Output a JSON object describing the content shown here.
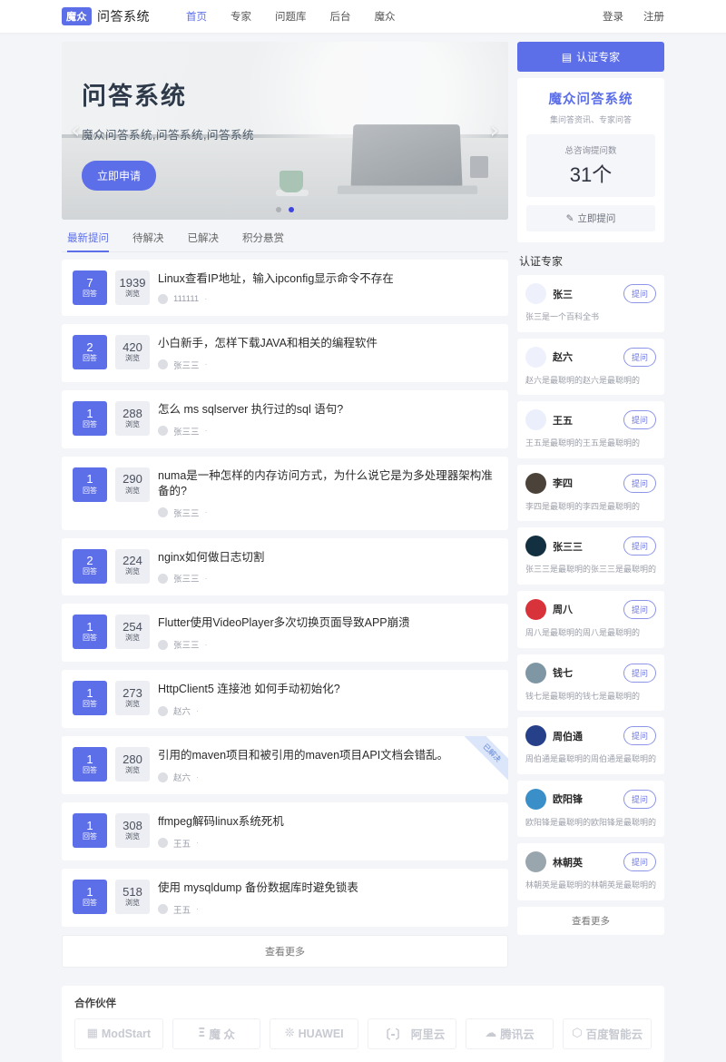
{
  "nav": {
    "logo_badge": "魔众",
    "logo_title": "问答系统",
    "links": [
      {
        "label": "首页",
        "active": true
      },
      {
        "label": "专家",
        "active": false
      },
      {
        "label": "问题库",
        "active": false
      },
      {
        "label": "后台",
        "active": false
      },
      {
        "label": "魔众",
        "active": false
      }
    ],
    "login": "登录",
    "register": "注册"
  },
  "carousel": {
    "heading": "问答系统",
    "subtitle": "魔众问答系统,问答系统,问答系统",
    "cta": "立即申请",
    "prev_icon": "chevron-left-icon",
    "next_icon": "chevron-right-icon",
    "dots": 2,
    "active_dot": 1
  },
  "tabs": [
    {
      "label": "最新提问",
      "active": true
    },
    {
      "label": "待解决",
      "active": false
    },
    {
      "label": "已解决",
      "active": false
    },
    {
      "label": "积分悬赏",
      "active": false
    }
  ],
  "question_labels": {
    "answers": "回答",
    "views": "浏览",
    "dot": "·"
  },
  "questions": [
    {
      "answers": "7",
      "views": "1939",
      "title": "Linux查看IP地址，输入ipconfig显示命令不存在",
      "author": "111111",
      "ribbon": ""
    },
    {
      "answers": "2",
      "views": "420",
      "title": "小白新手，怎样下载JAVA和相关的编程软件",
      "author": "张三三",
      "ribbon": ""
    },
    {
      "answers": "1",
      "views": "288",
      "title": "怎么 ms sqlserver 执行过的sql 语句?",
      "author": "张三三",
      "ribbon": ""
    },
    {
      "answers": "1",
      "views": "290",
      "title": "numa是一种怎样的内存访问方式，为什么说它是为多处理器架构准备的?",
      "author": "张三三",
      "ribbon": ""
    },
    {
      "answers": "2",
      "views": "224",
      "title": "nginx如何做日志切割",
      "author": "张三三",
      "ribbon": ""
    },
    {
      "answers": "1",
      "views": "254",
      "title": "Flutter使用VideoPlayer多次切换页面导致APP崩溃",
      "author": "张三三",
      "ribbon": ""
    },
    {
      "answers": "1",
      "views": "273",
      "title": "HttpClient5 连接池 如何手动初始化?",
      "author": "赵六",
      "ribbon": ""
    },
    {
      "answers": "1",
      "views": "280",
      "title": "引用的maven项目和被引用的maven项目API文档会错乱。",
      "author": "赵六",
      "ribbon": "已解决"
    },
    {
      "answers": "1",
      "views": "308",
      "title": "ffmpeg解码linux系统死机",
      "author": "王五",
      "ribbon": ""
    },
    {
      "answers": "1",
      "views": "518",
      "title": "使用 mysqldump 备份数据库时避免锁表",
      "author": "王五",
      "ribbon": ""
    }
  ],
  "list_more": "查看更多",
  "sidebar": {
    "header": "认证专家",
    "header_icon": "card-icon",
    "card_title": "魔众问答系统",
    "card_subtitle": "集问答资讯、专家问答",
    "stat_caption": "总咨询提问数",
    "stat_value": "31个",
    "ask_button": "立即提问",
    "ask_icon": "pen-icon",
    "experts_title": "认证专家",
    "ask_label": "提问",
    "experts": [
      {
        "name": "张三",
        "desc": "张三是一个百科全书",
        "avatar_color": "#eef1fb"
      },
      {
        "name": "赵六",
        "desc": "赵六是最聪明的赵六是最聪明的",
        "avatar_color": "#eef1fb"
      },
      {
        "name": "王五",
        "desc": "王五是最聪明的王五是最聪明的",
        "avatar_color": "#eaeffb"
      },
      {
        "name": "李四",
        "desc": "李四是最聪明的李四是最聪明的",
        "avatar_color": "#4b4339"
      },
      {
        "name": "张三三",
        "desc": "张三三是最聪明的张三三是最聪明的",
        "avatar_color": "#12303f"
      },
      {
        "name": "周八",
        "desc": "周八是最聪明的周八是最聪明的",
        "avatar_color": "#d8333a"
      },
      {
        "name": "钱七",
        "desc": "钱七是最聪明的钱七是最聪明的",
        "avatar_color": "#7f97a5"
      },
      {
        "name": "周伯通",
        "desc": "周伯通是最聪明的周伯通是最聪明的",
        "avatar_color": "#27408a"
      },
      {
        "name": "欧阳锋",
        "desc": "欧阳锋是最聪明的欧阳锋是最聪明的",
        "avatar_color": "#3b8fc9"
      },
      {
        "name": "林朝英",
        "desc": "林朝英是最聪明的林朝英是最聪明的",
        "avatar_color": "#9aa6ae"
      }
    ],
    "more": "查看更多"
  },
  "partners": {
    "title": "合作伙伴",
    "items": [
      {
        "glyph": "▦",
        "label": "ModStart"
      },
      {
        "glyph": "Ξ",
        "label": "魔 众"
      },
      {
        "glyph": "❊",
        "label": "HUAWEI"
      },
      {
        "glyph": "〔-〕",
        "label": "阿里云"
      },
      {
        "glyph": "☁",
        "label": "腾讯云"
      },
      {
        "glyph": "⬡",
        "label": "百度智能云"
      }
    ]
  }
}
